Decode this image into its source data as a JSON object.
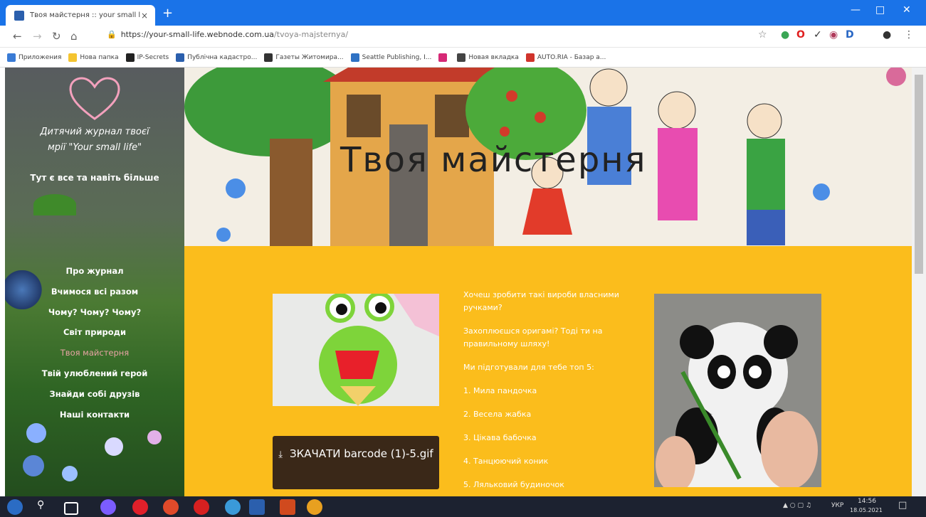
{
  "browser": {
    "tab_title": "Твоя майстерня :: your small life",
    "tab_close": "×",
    "new_tab": "+",
    "url_domain": "https://your-small-life.webnode.com.ua",
    "url_path": "/tvoya-majsternya/",
    "bookmarks": [
      {
        "label": "Приложения",
        "color": "#3a7bd5"
      },
      {
        "label": "Нова папка",
        "color": "#f4c430"
      },
      {
        "label": "IP-Secrets",
        "color": "#222222"
      },
      {
        "label": "Публічна кадастро...",
        "color": "#2b5fad"
      },
      {
        "label": "Газеты Житомира...",
        "color": "#333333"
      },
      {
        "label": "Seattle Publishing, I...",
        "color": "#2f72c4"
      },
      {
        "label": "",
        "color": "#d62976"
      },
      {
        "label": "Новая вкладка",
        "color": "#444444"
      },
      {
        "label": "AUTO.RIA - Базар а...",
        "color": "#d0342c"
      }
    ]
  },
  "sidebar": {
    "title_line1": "Дитячий журнал твоєї",
    "title_line2": "мрії \"Your small life\"",
    "subtitle": "Тут є все та навіть більше",
    "menu": [
      {
        "label": "Про журнал",
        "active": false
      },
      {
        "label": "Вчимося всі разом",
        "active": false
      },
      {
        "label": "Чому? Чому? Чому?",
        "active": false
      },
      {
        "label": "Світ природи",
        "active": false
      },
      {
        "label": "Твоя майстерня",
        "active": true
      },
      {
        "label": "Твій улюблений герой",
        "active": false
      },
      {
        "label": "Знайди собі друзів",
        "active": false
      },
      {
        "label": "Наші контакти",
        "active": false
      }
    ]
  },
  "banner": {
    "title": "Твоя майстерня"
  },
  "content": {
    "download_icon": "⤓",
    "download_label": "ЗКАЧАТИ barcode (1)-5.gif",
    "paragraphs": [
      "Хочеш зробити такі вироби власними ручками?",
      "Захоплюєшся оригамі?  Тоді ти на правильному шляху!",
      "Ми підготували для тебе топ 5:"
    ],
    "list": [
      "1. Мила пандочка",
      "2. Весела жабка",
      "3. Цікава бабочка",
      "4. Танцюючий коник",
      "5. Ляльковий будиночок"
    ]
  },
  "taskbar": {
    "lang": "УКР",
    "time": "14:56",
    "date": "18.05.2021"
  },
  "colors": {
    "accent": "#1a73e8",
    "content_bg": "#fbbd1c",
    "button_bg": "#3a2818",
    "active_menu": "#e8a4a4"
  }
}
